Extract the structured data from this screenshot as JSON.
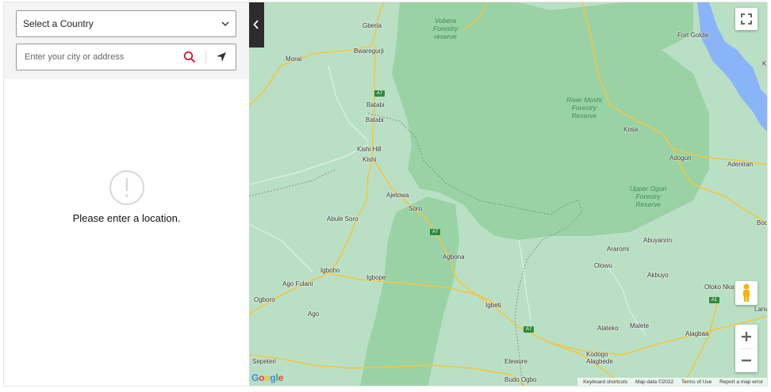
{
  "sidebar": {
    "country_select": {
      "value": "Select a Country"
    },
    "search": {
      "placeholder": "Enter your city or address"
    },
    "empty_state": {
      "message": "Please enter a location."
    }
  },
  "map": {
    "forest_labels": {
      "vobera": "Vobera\nForestry\nreserve",
      "river_moshi": "River Moshi\nForestry\nReserve",
      "upper_ogun": "Upper Ogun\nForestry\nReserve"
    },
    "places": {
      "gberia": "Gberia",
      "bwaregurji": "Bwaregurji",
      "morai": "Morai",
      "batabi1": "Batabi",
      "batabi2": "Batabi",
      "kishi_hill": "Kishi Hill",
      "kishi": "Kishi",
      "ajetowa": "Ajetowa",
      "soro": "Soro",
      "abule_soro": "Abule Soro",
      "agbona": "Agbona",
      "igboho": "Igboho",
      "igbope": "Igbope",
      "ago_fulani": "Ago Fulani",
      "ogboro": "Ogboro",
      "ago": "Ago",
      "igbeti": "Igbeti",
      "sepeteri": "Sepeteri",
      "elewure": "Elewure",
      "budo_ogbo": "Budo Ogbo",
      "kodogo_alagbede": "Kodogo\nAlagbede",
      "alateko": "Alateko",
      "malete": "Malete",
      "alagbaa": "Alagbaa",
      "akbuyo": "Akbuyo",
      "olowu": "Olowu",
      "araromi": "Araromi",
      "abuyanrin": "Abuyanrin",
      "oloko_nka": "Oloko Nka",
      "lanwa": "Lanw",
      "bod": "Bod",
      "adeniran": "Adeniran",
      "adogun": "Adogun",
      "kosa": "Kosa",
      "fort_goldie": "Fort Goldie",
      "k": "K"
    },
    "road_shields": {
      "a7_1": "A7",
      "a7_2": "A7",
      "a7_3": "A7",
      "a1": "A1"
    },
    "attribution": {
      "shortcuts": "Keyboard shortcuts",
      "map_data": "Map data ©2022",
      "terms": "Terms of Use",
      "report": "Report a map error"
    },
    "logo": {
      "g": "G",
      "o1": "o",
      "o2": "o",
      "g2": "g",
      "l": "l",
      "e": "e"
    },
    "colors": {
      "land": "#b9e0c4",
      "forest": "#99d3a5",
      "water": "#8ab4f8",
      "road": "#f5c542",
      "highway": "#f1a83a"
    }
  }
}
